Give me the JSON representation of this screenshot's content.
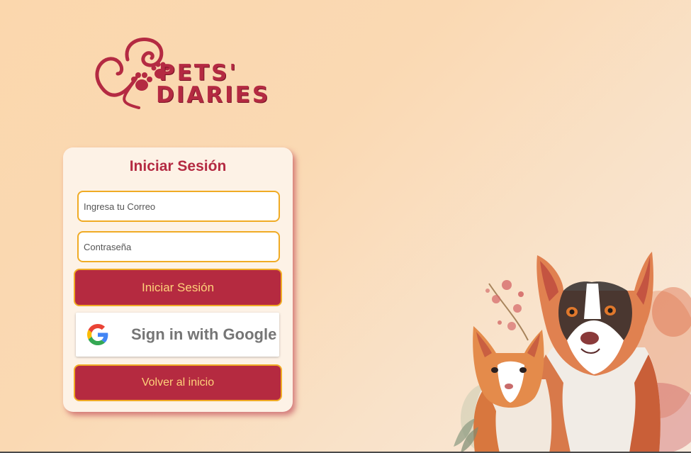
{
  "logo": {
    "line1": "PETS'",
    "line2": "DIARIES"
  },
  "login": {
    "title": "Iniciar Sesión",
    "email_placeholder": "Ingresa tu Correo",
    "password_placeholder": "Contraseña",
    "submit_label": "Iniciar Sesión",
    "google_label": "Sign in with Google",
    "back_label": "Volver al inicio"
  },
  "colors": {
    "brand": "#b42a42",
    "accent": "#f0ab25",
    "button_text": "#ffd27a",
    "card_bg": "#fdf2e6"
  },
  "icons": [
    "heart-paw-logo-icon",
    "google-g-icon",
    "dog-cat-watercolor-illustration"
  ]
}
